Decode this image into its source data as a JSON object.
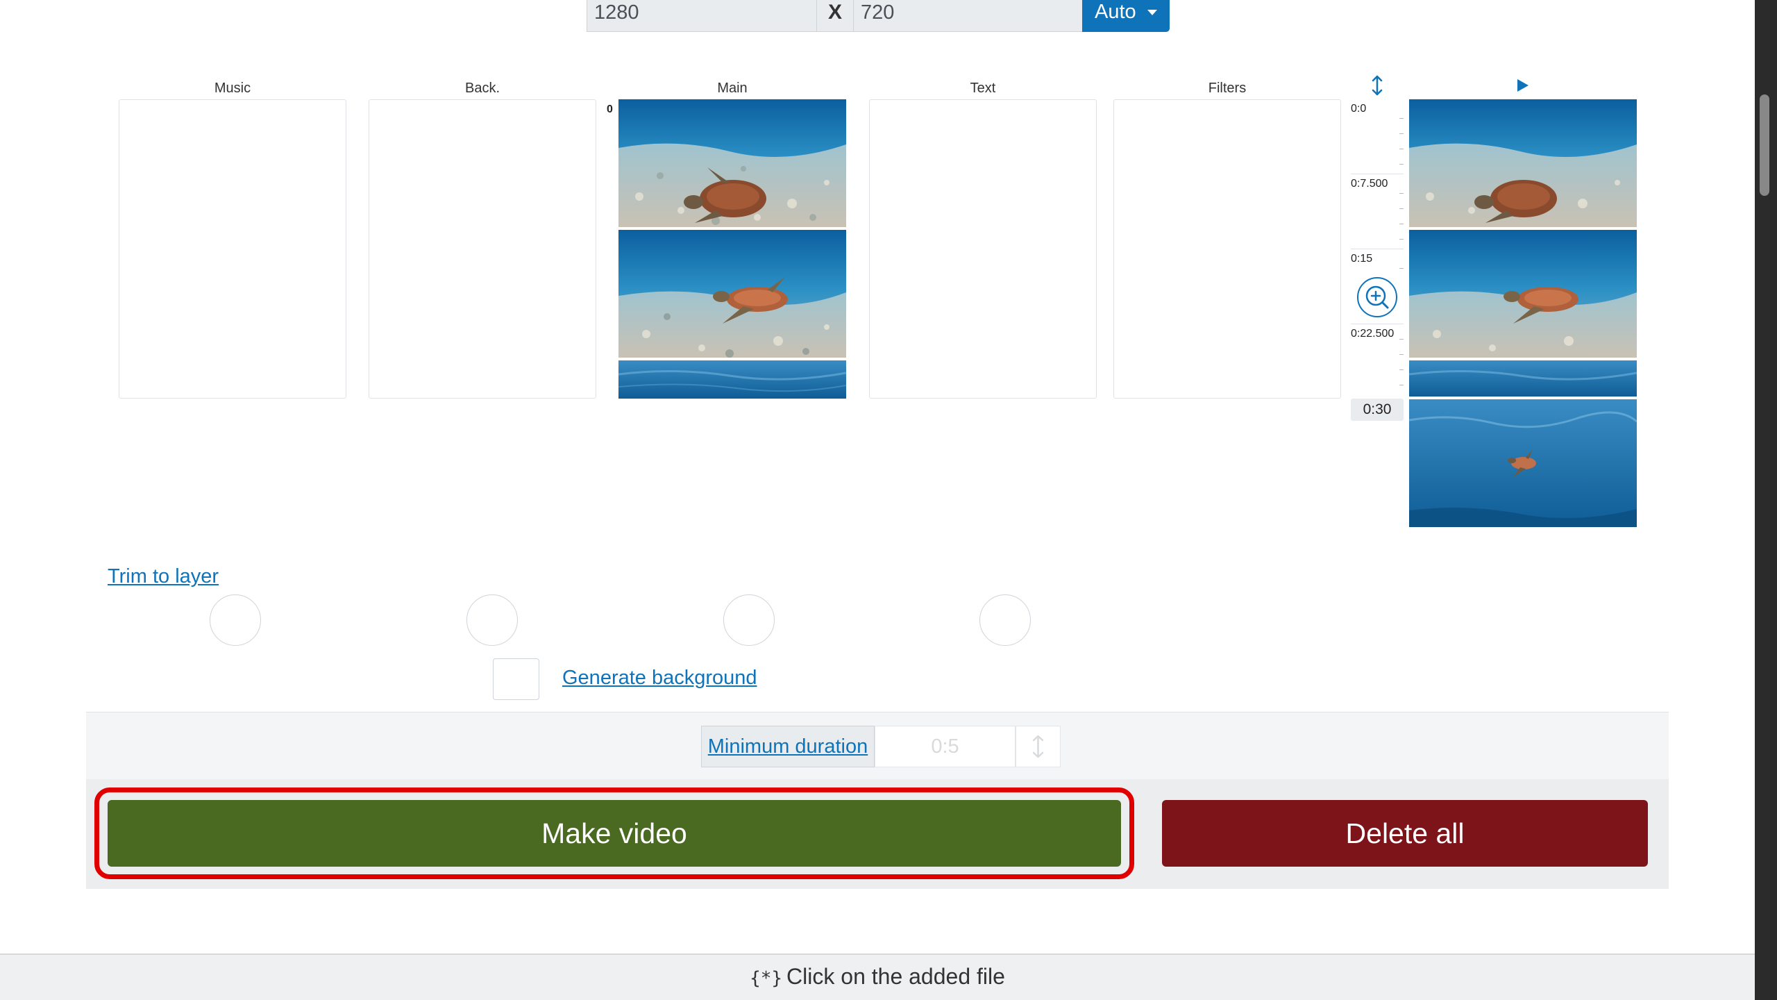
{
  "resolution": {
    "width": "1280",
    "separator": "X",
    "height": "720",
    "preset_label": "Auto"
  },
  "layers": [
    {
      "label": "Music"
    },
    {
      "label": "Back."
    },
    {
      "label": "Main"
    },
    {
      "label": "Text"
    },
    {
      "label": "Filters"
    }
  ],
  "main_layer_start": "0",
  "timeline": {
    "marks": [
      "0:0",
      "0:7.500",
      "0:15",
      "0:22.500"
    ],
    "end": "0:30"
  },
  "icons": {
    "vertical_resize": "vertical-arrows-icon",
    "play": "play-icon",
    "zoom": "zoom-in-icon",
    "hint": "asterisk-braces-icon"
  },
  "trim_link": "Trim to layer",
  "generate_background_link": "Generate background",
  "minimum_duration": {
    "label": "Minimum duration",
    "placeholder": "0:5"
  },
  "actions": {
    "make_video": "Make video",
    "delete_all": "Delete all"
  },
  "footer": {
    "icon": "{*}",
    "hint": "Click on the added file"
  },
  "colors": {
    "primary": "#0f73b9",
    "make_video": "#4a6a22",
    "delete_all": "#7c1419",
    "highlight": "#e00000"
  }
}
